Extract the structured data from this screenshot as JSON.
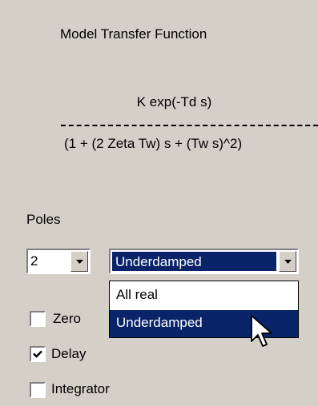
{
  "panel": {
    "title": "Model Transfer Function",
    "numerator": "K exp(-Td s)",
    "denominator": "(1 + (2 Zeta Tw) s + (Tw s)^2)"
  },
  "poles": {
    "label": "Poles",
    "count_value": "2",
    "type_value": "Underdamped",
    "type_options": [
      "All real",
      "Underdamped"
    ],
    "highlighted_option": "Underdamped"
  },
  "checkboxes": [
    {
      "label": "Zero",
      "checked": false
    },
    {
      "label": "Delay",
      "checked": true
    },
    {
      "label": "Integrator",
      "checked": false
    }
  ],
  "colors": {
    "background": "#d4d0c8",
    "selection": "#0a246a"
  },
  "icons": {
    "dropdown_arrow": "chevron-down-icon",
    "checkmark": "checkmark-icon",
    "cursor": "mouse-pointer-icon"
  }
}
